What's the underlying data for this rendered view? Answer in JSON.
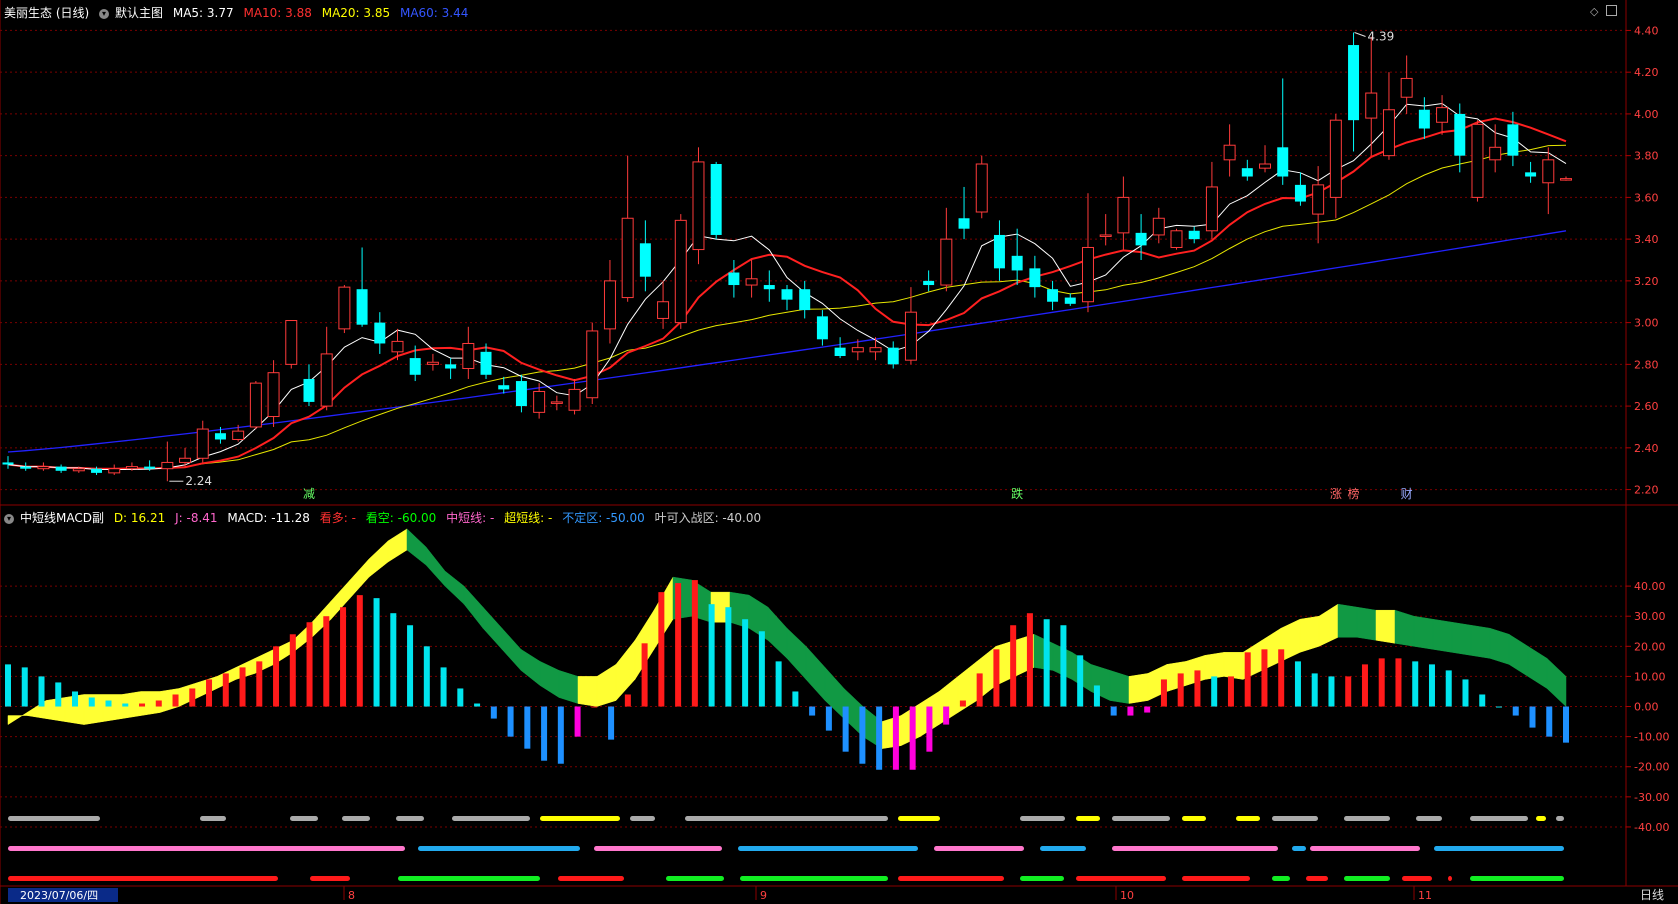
{
  "main_header": {
    "title": "美丽生态 (日线)",
    "chart_name": "默认主图",
    "ma5": "MA5: 3.77",
    "ma10": "MA10: 3.88",
    "ma20": "MA20: 3.85",
    "ma60": "MA60: 3.44"
  },
  "sub_header": {
    "title": "中短线MACD副",
    "d": "D: 16.21",
    "j": "J: -8.41",
    "macd": "MACD: -11.28",
    "bull": "看多: -",
    "bear": "看空: -60.00",
    "mid": "中短线: -",
    "short": "超短线: -",
    "neutral": "不定区: -50.00",
    "yeke": "叶可入战区: -40.00"
  },
  "colors": {
    "up": "#ff3b3b",
    "down": "#00ffff",
    "ma5": "#ffffff",
    "ma10": "#ff2020",
    "ma20": "#e6e600",
    "ma60": "#2222ff",
    "grid": "#7a0000"
  },
  "chart_data": [
    {
      "type": "candlestick",
      "ylim": [
        2.15,
        4.45
      ],
      "price_ticks": [
        "4.40",
        "4.20",
        "4.00",
        "3.80",
        "3.60",
        "3.40",
        "3.20",
        "3.00",
        "2.80",
        "2.60",
        "2.40",
        "2.20"
      ],
      "annotations": {
        "high": "4.39",
        "low": "2.24"
      },
      "event_markers": [
        "减",
        "跌",
        "涨",
        "榜",
        "财"
      ],
      "candles": [
        [
          2.33,
          2.32,
          2.36,
          2.3
        ],
        [
          2.31,
          2.3,
          2.33,
          2.29
        ],
        [
          2.3,
          2.31,
          2.33,
          2.29
        ],
        [
          2.31,
          2.29,
          2.32,
          2.28
        ],
        [
          2.29,
          2.3,
          2.31,
          2.28
        ],
        [
          2.3,
          2.28,
          2.31,
          2.27
        ],
        [
          2.28,
          2.3,
          2.32,
          2.27
        ],
        [
          2.3,
          2.31,
          2.33,
          2.29
        ],
        [
          2.31,
          2.3,
          2.34,
          2.29
        ],
        [
          2.3,
          2.33,
          2.43,
          2.24
        ],
        [
          2.33,
          2.35,
          2.4,
          2.31
        ],
        [
          2.35,
          2.49,
          2.53,
          2.33
        ],
        [
          2.47,
          2.44,
          2.5,
          2.42
        ],
        [
          2.44,
          2.48,
          2.51,
          2.43
        ],
        [
          2.5,
          2.71,
          2.72,
          2.49
        ],
        [
          2.55,
          2.76,
          2.82,
          2.5
        ],
        [
          2.8,
          3.01,
          3.0,
          2.78
        ],
        [
          2.73,
          2.62,
          2.8,
          2.6
        ],
        [
          2.6,
          2.85,
          2.98,
          2.58
        ],
        [
          2.97,
          3.17,
          3.18,
          2.95
        ],
        [
          3.16,
          2.99,
          3.36,
          2.98
        ],
        [
          3.0,
          2.9,
          3.05,
          2.85
        ],
        [
          2.86,
          2.91,
          2.97,
          2.82
        ],
        [
          2.83,
          2.75,
          2.89,
          2.72
        ],
        [
          2.8,
          2.81,
          2.85,
          2.77
        ],
        [
          2.8,
          2.78,
          2.83,
          2.73
        ],
        [
          2.78,
          2.9,
          2.98,
          2.73
        ],
        [
          2.86,
          2.75,
          2.9,
          2.73
        ],
        [
          2.7,
          2.68,
          2.74,
          2.66
        ],
        [
          2.72,
          2.6,
          2.75,
          2.57
        ],
        [
          2.57,
          2.67,
          2.71,
          2.54
        ],
        [
          2.62,
          2.62,
          2.65,
          2.58
        ],
        [
          2.58,
          2.68,
          2.73,
          2.56
        ],
        [
          2.64,
          2.96,
          3.0,
          2.61
        ],
        [
          2.97,
          3.2,
          3.3,
          2.9
        ],
        [
          3.12,
          3.5,
          3.8,
          3.1
        ],
        [
          3.38,
          3.22,
          3.49,
          3.15
        ],
        [
          3.02,
          3.1,
          3.2,
          2.97
        ],
        [
          3.0,
          3.49,
          3.52,
          2.97
        ],
        [
          3.35,
          3.77,
          3.84,
          3.28
        ],
        [
          3.76,
          3.42,
          3.77,
          3.4
        ],
        [
          3.24,
          3.18,
          3.3,
          3.12
        ],
        [
          3.18,
          3.21,
          3.3,
          3.12
        ],
        [
          3.18,
          3.16,
          3.25,
          3.1
        ],
        [
          3.16,
          3.11,
          3.18,
          3.06
        ],
        [
          3.16,
          3.06,
          3.2,
          3.02
        ],
        [
          3.03,
          2.92,
          3.06,
          2.89
        ],
        [
          2.88,
          2.84,
          2.93,
          2.83
        ],
        [
          2.86,
          2.88,
          2.92,
          2.82
        ],
        [
          2.86,
          2.88,
          2.93,
          2.82
        ],
        [
          2.88,
          2.8,
          2.91,
          2.78
        ],
        [
          2.82,
          3.05,
          3.17,
          2.8
        ],
        [
          3.2,
          3.18,
          3.25,
          3.15
        ],
        [
          3.18,
          3.4,
          3.55,
          3.15
        ],
        [
          3.5,
          3.45,
          3.65,
          3.4
        ],
        [
          3.53,
          3.76,
          3.8,
          3.5
        ],
        [
          3.42,
          3.26,
          3.49,
          3.2
        ],
        [
          3.32,
          3.25,
          3.45,
          3.18
        ],
        [
          3.26,
          3.17,
          3.32,
          3.12
        ],
        [
          3.16,
          3.1,
          3.2,
          3.06
        ],
        [
          3.12,
          3.09,
          3.14,
          3.08
        ],
        [
          3.1,
          3.36,
          3.62,
          3.05
        ],
        [
          3.42,
          3.42,
          3.52,
          3.37
        ],
        [
          3.43,
          3.6,
          3.7,
          3.35
        ],
        [
          3.43,
          3.37,
          3.52,
          3.3
        ],
        [
          3.42,
          3.5,
          3.55,
          3.38
        ],
        [
          3.36,
          3.44,
          3.45,
          3.35
        ],
        [
          3.44,
          3.4,
          3.46,
          3.38
        ],
        [
          3.44,
          3.65,
          3.77,
          3.4
        ],
        [
          3.78,
          3.85,
          3.95,
          3.7
        ],
        [
          3.74,
          3.7,
          3.78,
          3.68
        ],
        [
          3.74,
          3.76,
          3.85,
          3.72
        ],
        [
          3.84,
          3.7,
          4.17,
          3.66
        ],
        [
          3.66,
          3.58,
          3.72,
          3.56
        ],
        [
          3.52,
          3.66,
          3.75,
          3.38
        ],
        [
          3.6,
          3.97,
          4.0,
          3.5
        ],
        [
          4.33,
          3.97,
          4.39,
          3.82
        ],
        [
          3.98,
          4.1,
          4.37,
          3.8
        ],
        [
          3.8,
          4.02,
          4.2,
          3.78
        ],
        [
          4.08,
          4.17,
          4.28,
          4.0
        ],
        [
          4.02,
          3.93,
          4.08,
          3.88
        ],
        [
          3.96,
          4.03,
          4.09,
          3.9
        ],
        [
          4.0,
          3.8,
          4.05,
          3.72
        ],
        [
          3.6,
          3.95,
          3.97,
          3.58
        ],
        [
          3.78,
          3.84,
          3.95,
          3.72
        ],
        [
          3.95,
          3.8,
          4.01,
          3.75
        ],
        [
          3.72,
          3.7,
          3.77,
          3.67
        ],
        [
          3.67,
          3.78,
          3.84,
          3.52
        ],
        [
          3.69,
          3.69,
          3.7,
          3.68
        ]
      ]
    },
    {
      "type": "indicator",
      "ylim": [
        -45,
        50
      ],
      "ticks": [
        "40.00",
        "30.00",
        "20.00",
        "10.00",
        "0.00",
        "-10.00",
        "-20.00",
        "-30.00",
        "-40.00"
      ],
      "macd_bars": [
        14,
        13,
        10,
        8,
        5,
        3,
        2,
        1,
        1,
        2,
        4,
        6,
        9,
        11,
        13,
        15,
        20,
        24,
        28,
        30,
        33,
        37,
        36,
        31,
        27,
        20,
        13,
        6,
        1,
        -4,
        -10,
        -14,
        -18,
        -19,
        -10,
        0,
        -11,
        4,
        21,
        38,
        41,
        42,
        34,
        33,
        29,
        25,
        15,
        5,
        -3,
        -8,
        -15,
        -19,
        -21,
        -21,
        -21,
        -15,
        -6,
        2,
        11,
        19,
        27,
        31,
        29,
        27,
        17,
        7,
        -3,
        -3,
        -2,
        9,
        11,
        12,
        10,
        10,
        18,
        19,
        19,
        15,
        11,
        10,
        10,
        14,
        16,
        16,
        15,
        14,
        12,
        9,
        4,
        0,
        -3,
        -7,
        -10,
        -12
      ],
      "signal_d": [
        -6,
        -2,
        2,
        3,
        4,
        4,
        4,
        5,
        5,
        6,
        8,
        10,
        13,
        16,
        19,
        22,
        28,
        35,
        42,
        49,
        55,
        59,
        53,
        45,
        40,
        33,
        26,
        19,
        15,
        12,
        10,
        10,
        14,
        22,
        32,
        43,
        42,
        38,
        38,
        37,
        33,
        26,
        20,
        13,
        6,
        0,
        -5,
        -3,
        1,
        5,
        10,
        15,
        20,
        22,
        24,
        21,
        18,
        14,
        12,
        10,
        11,
        14,
        15,
        17,
        18,
        18,
        22,
        26,
        29,
        30,
        34,
        33,
        32,
        32,
        30,
        29,
        28,
        27,
        26,
        24,
        20,
        16,
        10
      ],
      "signal_j": [
        5,
        5,
        4,
        3,
        2,
        3,
        4,
        5,
        6,
        8,
        11,
        14,
        17,
        19,
        22,
        26,
        31,
        37,
        44,
        51,
        56,
        60,
        55,
        48,
        42,
        34,
        27,
        20,
        15,
        11,
        9,
        8,
        10,
        17,
        27,
        37,
        38,
        36,
        36,
        34,
        30,
        24,
        17,
        10,
        4,
        -2,
        -6,
        -5,
        -2,
        2,
        6,
        10,
        15,
        18,
        21,
        20,
        17,
        13,
        10,
        9,
        10,
        13,
        15,
        17,
        18,
        17,
        20,
        23,
        26,
        28,
        31,
        31,
        30,
        29,
        28,
        27,
        26,
        25,
        24,
        22,
        18,
        14,
        8
      ]
    }
  ],
  "sub_bars": {
    "row1": "grey/yellow status bars",
    "row2": "pink/blue status bars",
    "row3": "red/green status bars"
  },
  "x_axis": {
    "date_label": "2023/07/06/四",
    "months": [
      "8",
      "9",
      "10",
      "11"
    ],
    "period": "日线"
  }
}
